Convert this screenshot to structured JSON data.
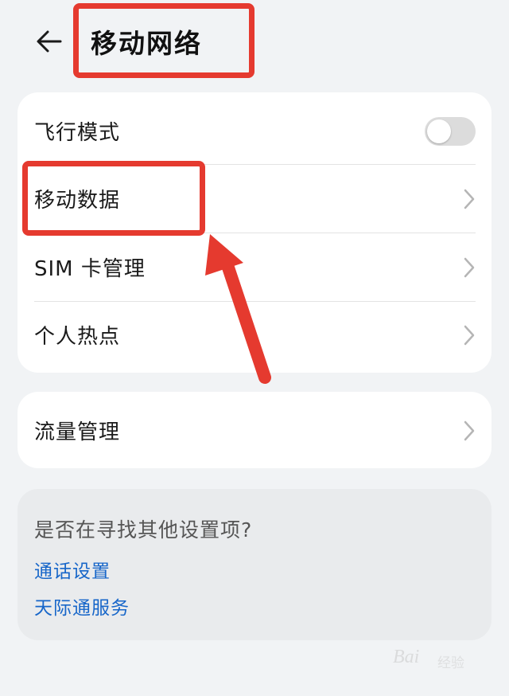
{
  "header": {
    "title": "移动网络",
    "back_icon": "arrow-left-icon"
  },
  "main_card": {
    "items": [
      {
        "label": "飞行模式",
        "control": "toggle",
        "toggle_on": false
      },
      {
        "label": "移动数据",
        "control": "chevron-right-icon"
      },
      {
        "label": "SIM 卡管理",
        "control": "chevron-right-icon"
      },
      {
        "label": "个人热点",
        "control": "chevron-right-icon"
      }
    ]
  },
  "traffic_card": {
    "items": [
      {
        "label": "流量管理",
        "control": "chevron-right-icon"
      }
    ]
  },
  "suggestions": {
    "title": "是否在寻找其他设置项?",
    "links": [
      "通话设置",
      "天际通服务"
    ]
  },
  "annotations": {
    "highlight_color": "#e53a2f"
  },
  "watermark": {
    "brand": "Bai",
    "sub": "经验"
  },
  "colors": {
    "background": "#f1f3f5",
    "card": "#ffffff",
    "link": "#1766c9",
    "toggle_off": "#dcdcdc"
  }
}
